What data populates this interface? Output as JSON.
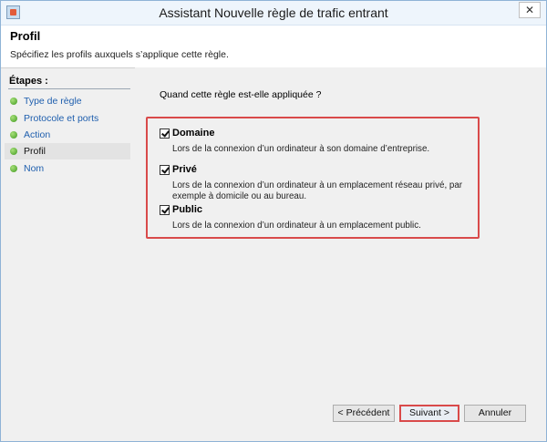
{
  "window": {
    "title": "Assistant Nouvelle règle de trafic entrant",
    "close_label": "✕"
  },
  "header": {
    "title": "Profil",
    "description": "Spécifiez les profils auxquels s’applique cette règle."
  },
  "steps": {
    "title": "Étapes :",
    "items": [
      {
        "label": "Type de règle",
        "active": false
      },
      {
        "label": "Protocole et ports",
        "active": false
      },
      {
        "label": "Action",
        "active": false
      },
      {
        "label": "Profil",
        "active": true
      },
      {
        "label": "Nom",
        "active": false
      }
    ]
  },
  "main": {
    "question": "Quand cette règle est-elle appliquée ?",
    "profiles": [
      {
        "label": "Domaine",
        "checked": true,
        "description": "Lors de la connexion d’un ordinateur à son domaine d’entreprise."
      },
      {
        "label": "Privé",
        "checked": true,
        "description": "Lors de la connexion d’un ordinateur à un emplacement réseau privé, par exemple à domicile ou au bureau."
      },
      {
        "label": "Public",
        "checked": true,
        "description": "Lors de la connexion d’un ordinateur à un emplacement public."
      }
    ]
  },
  "buttons": {
    "previous": "< Précédent",
    "next": "Suivant >",
    "cancel": "Annuler"
  },
  "colors": {
    "highlight": "#d94a4a",
    "link": "#1f5fae",
    "bullet": "#3f9a1f"
  }
}
